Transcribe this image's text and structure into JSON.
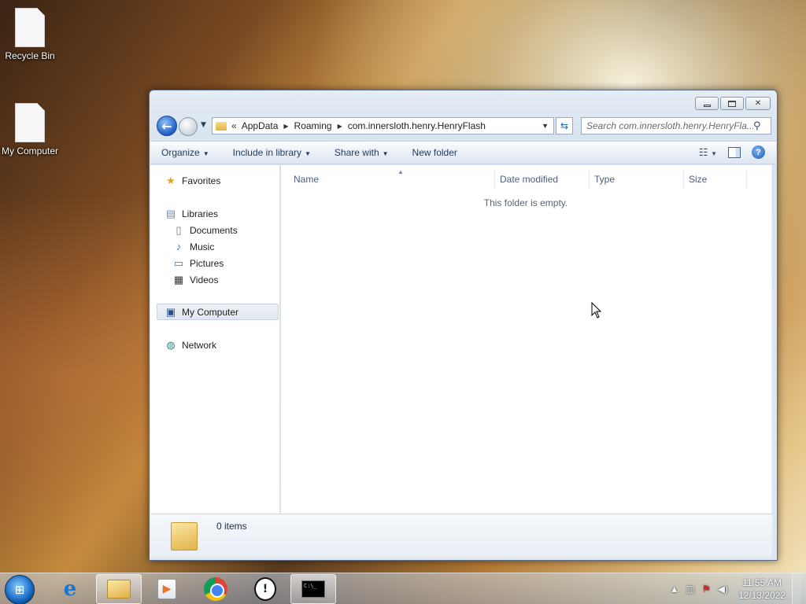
{
  "desktop": {
    "icons": [
      {
        "label": "Recycle Bin",
        "icon": "document-icon"
      },
      {
        "label": "My Computer",
        "icon": "document-icon"
      }
    ]
  },
  "window": {
    "address": {
      "chevron": "«",
      "crumbs": [
        "AppData",
        "Roaming",
        "com.innersloth.henry.HenryFlash"
      ]
    },
    "search": {
      "placeholder": "Search com.innersloth.henry.HenryFla..."
    },
    "toolbar": {
      "organize": "Organize",
      "include_in_library": "Include in library",
      "share_with": "Share with",
      "new_folder": "New folder"
    },
    "nav_pane": {
      "favorites": "Favorites",
      "libraries": "Libraries",
      "library_items": [
        "Documents",
        "Music",
        "Pictures",
        "Videos"
      ],
      "my_computer": "My Computer",
      "network": "Network"
    },
    "columns": {
      "name": "Name",
      "date_modified": "Date modified",
      "type": "Type",
      "size": "Size"
    },
    "empty_message": "This folder is empty.",
    "details": {
      "item_count": "0 items"
    }
  },
  "taskbar": {
    "pinned": [
      "ie-icon",
      "explorer-icon",
      "media-player-icon",
      "chrome-icon",
      "clock-app-icon",
      "cmd-icon"
    ],
    "tray": {
      "time": "11:55 AM",
      "date": "12/13/2022"
    }
  },
  "colors": {
    "accent": "#1f5fc4",
    "window_frame": "#dfe8f2",
    "toolbar_text": "#1e395b"
  }
}
